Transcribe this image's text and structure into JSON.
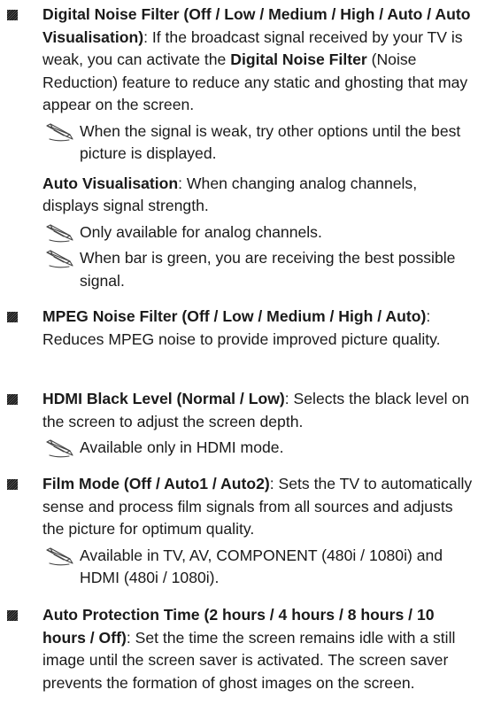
{
  "items": [
    {
      "title": "Digital Noise Filter (Off / Low / Medium / High / Auto / Auto Visualisation)",
      "text_1": ": If the broadcast signal received by your TV is weak, you can activate the ",
      "bold_1": "Digital Noise Filter",
      "text_2": " (Noise Reduction) feature to reduce any static and ghosting that may appear on the screen.",
      "note_1": "When the signal is weak, try other options until the best picture is displayed.",
      "sub_title": "Auto Visualisation",
      "sub_text": ": When changing analog channels, displays signal strength.",
      "note_2": "Only available for analog channels.",
      "note_3": "When bar is green, you are receiving the best possible signal."
    },
    {
      "title": "MPEG Noise Filter (Off / Low / Medium / High / Auto)",
      "text": ": Reduces MPEG noise to provide improved picture quality."
    },
    {
      "title": "HDMI Black Level (Normal / Low)",
      "text": ": Selects the black level on the screen to adjust the screen depth.",
      "note": "Available only in HDMI mode."
    },
    {
      "title": "Film Mode (Off / Auto1 / Auto2)",
      "text": ": Sets the TV to automatically sense and process film signals from all sources and adjusts the picture for optimum quality.",
      "note": "Available in TV, AV, COMPONENT (480i / 1080i) and HDMI (480i / 1080i)."
    },
    {
      "title": "Auto Protection Time (2 hours / 4 hours / 8 hours / 10 hours / Off)",
      "text": ": Set the time the screen remains idle with a still image until the screen saver is activated. The screen saver prevents the formation of ghost images on the screen."
    }
  ],
  "icons": {
    "bullet": "square-bullet-icon",
    "note": "pencil-note-icon"
  }
}
